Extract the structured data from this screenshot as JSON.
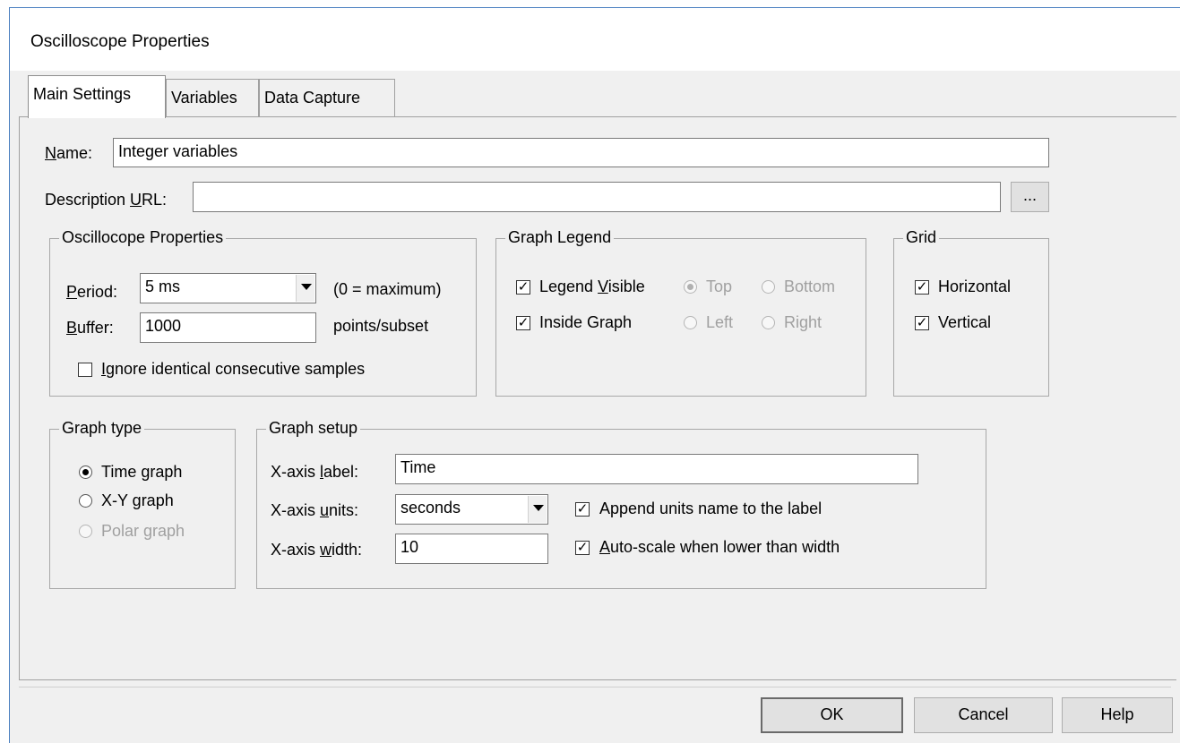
{
  "dialog": {
    "title": "Oscilloscope Properties"
  },
  "tabs": [
    {
      "label": "Main Settings",
      "active": true
    },
    {
      "label": "Variables",
      "active": false
    },
    {
      "label": "Data Capture",
      "active": false
    }
  ],
  "main": {
    "name": {
      "label_pre": "",
      "label_key": "N",
      "label_post": "ame:",
      "value": "Integer variables"
    },
    "description_url": {
      "label_pre": "Description ",
      "label_key": "U",
      "label_post": "RL:",
      "value": "",
      "browse_label": "..."
    }
  },
  "osc_props": {
    "title": "Oscillocope Properties",
    "period": {
      "label_pre": "",
      "label_key": "P",
      "label_post": "eriod:",
      "value": "5 ms",
      "hint": "(0 = maximum)"
    },
    "buffer": {
      "label_pre": "",
      "label_key": "B",
      "label_post": "uffer:",
      "value": "1000",
      "unit": "points/subset"
    },
    "ignore_identical": {
      "label_pre": "",
      "label_key": "I",
      "label_post": "gnore identical consecutive samples",
      "checked": false
    }
  },
  "graph_legend": {
    "title": "Graph Legend",
    "legend_visible": {
      "label_pre": "Legend ",
      "label_key": "V",
      "label_post": "isible",
      "checked": true
    },
    "inside_graph": {
      "label": "Inside Graph",
      "checked": true
    },
    "positions": {
      "top": {
        "label": "Top",
        "selected": true
      },
      "bottom": {
        "label": "Bottom",
        "selected": false
      },
      "left": {
        "label": "Left",
        "selected": false
      },
      "right": {
        "label": "Right",
        "selected": false
      }
    }
  },
  "grid": {
    "title": "Grid",
    "horizontal": {
      "label": "Horizontal",
      "checked": true
    },
    "vertical": {
      "label": "Vertical",
      "checked": true
    }
  },
  "graph_type": {
    "title": "Graph type",
    "time_graph": {
      "label": "Time graph",
      "selected": true
    },
    "xy_graph": {
      "label": "X-Y graph",
      "selected": false
    },
    "polar_graph": {
      "label": "Polar graph",
      "selected": false
    }
  },
  "graph_setup": {
    "title": "Graph setup",
    "xaxis_label": {
      "label_pre": "X-axis ",
      "label_key": "l",
      "label_post": "abel:",
      "value": "Time"
    },
    "xaxis_units": {
      "label_pre": "X-axis ",
      "label_key": "u",
      "label_post": "nits:",
      "value": "seconds"
    },
    "xaxis_width": {
      "label_pre": "X-axis ",
      "label_key": "w",
      "label_post": "idth:",
      "value": "10"
    },
    "append_units": {
      "label": "Append units name to the label",
      "checked": true
    },
    "auto_scale": {
      "label_pre": "",
      "label_key": "A",
      "label_post": "uto-scale when lower than width",
      "checked": true
    }
  },
  "buttons": {
    "ok": "OK",
    "cancel": "Cancel",
    "help": "Help"
  },
  "icons": {
    "checkmark": "check-icon",
    "dropdown": "chevron-down-icon"
  }
}
